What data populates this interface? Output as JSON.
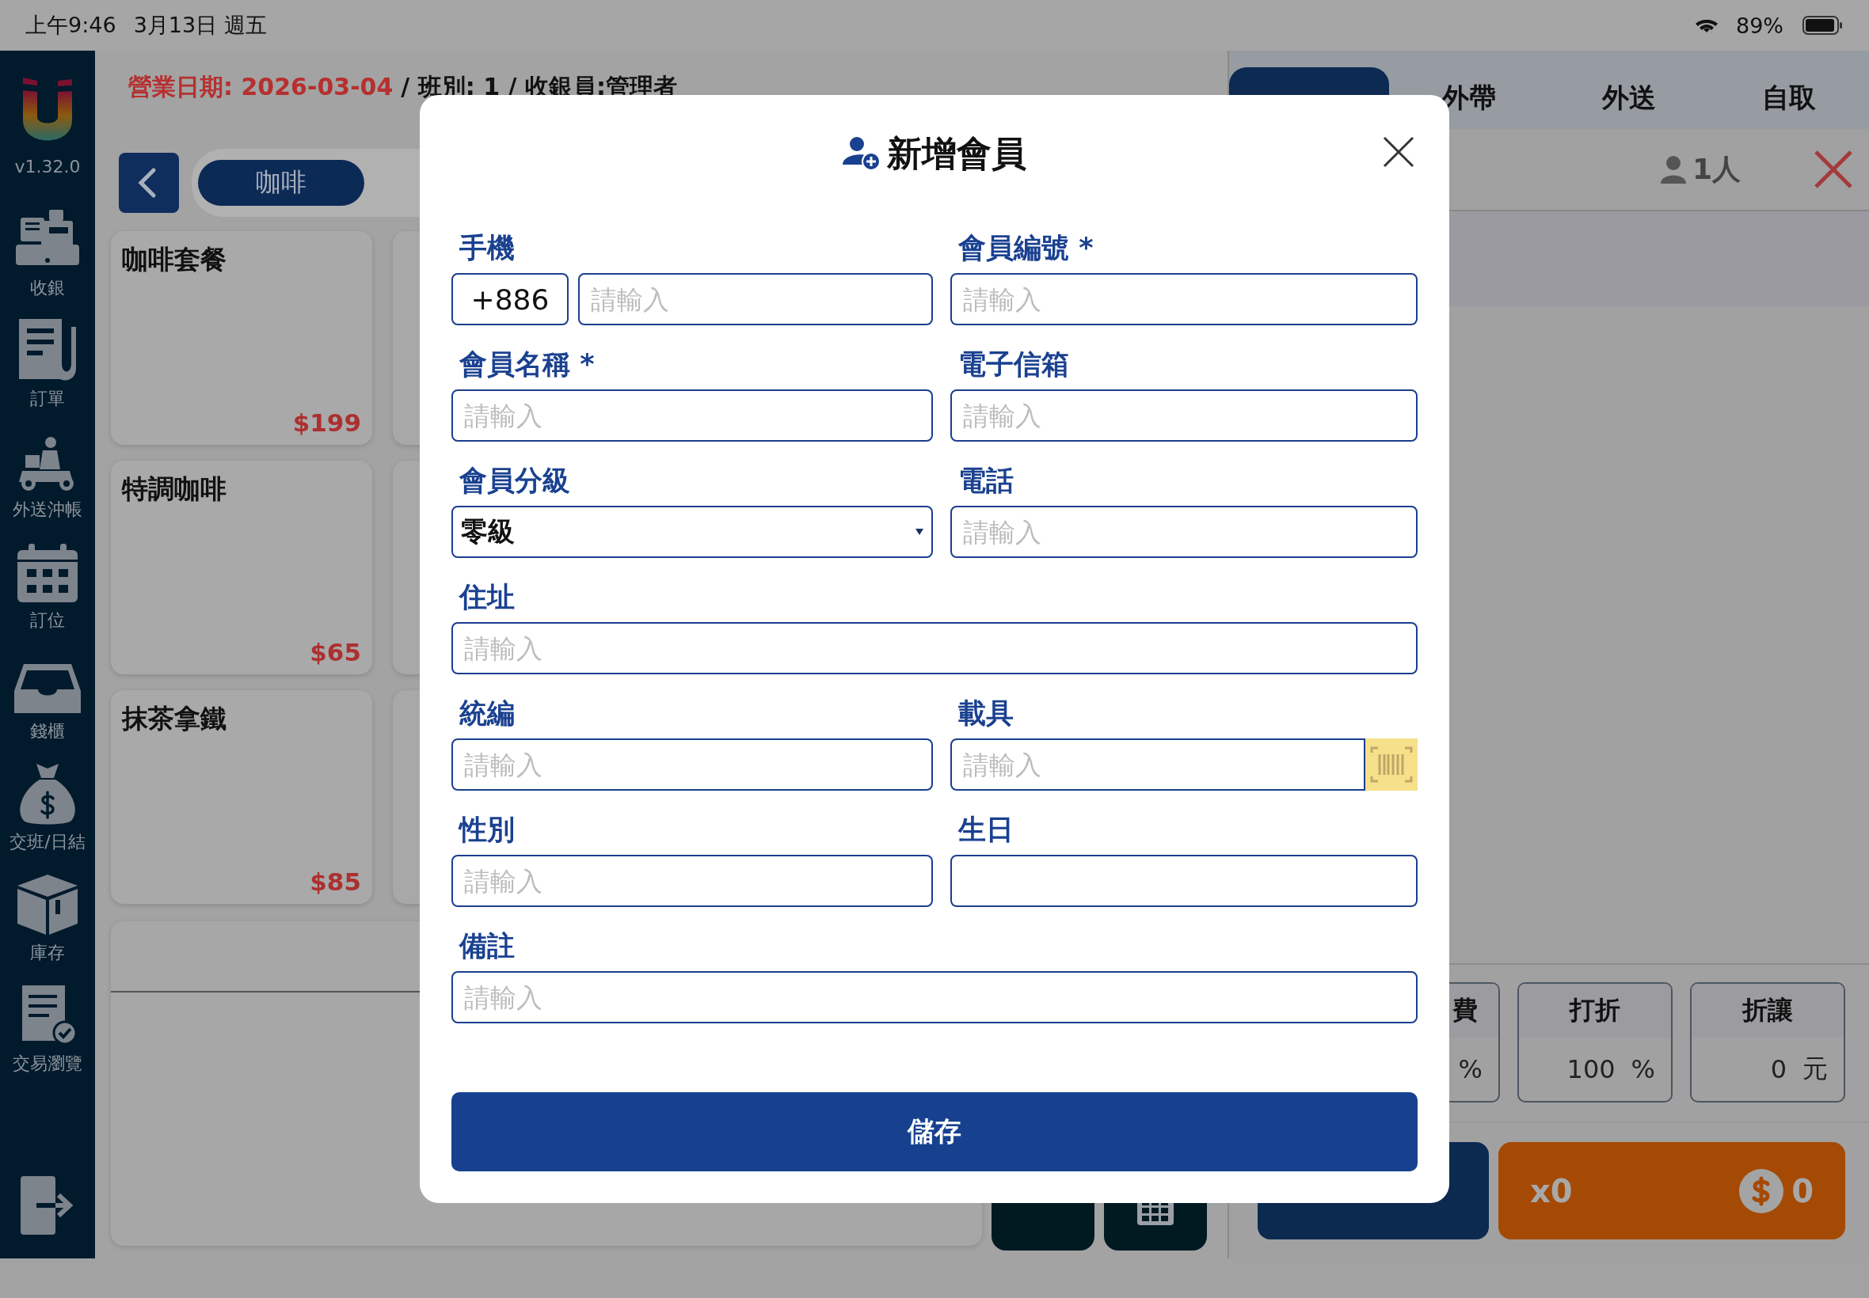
{
  "status_bar": {
    "time": "上午9:46",
    "date": "3月13日 週五",
    "battery": "89%"
  },
  "sidebar": {
    "version": "v1.32.0",
    "items": [
      {
        "label": "收銀"
      },
      {
        "label": "訂單"
      },
      {
        "label": "外送沖帳"
      },
      {
        "label": "訂位"
      },
      {
        "label": "錢櫃"
      },
      {
        "label": "交班/日結"
      },
      {
        "label": "庫存"
      },
      {
        "label": "交易瀏覽"
      }
    ]
  },
  "header": {
    "business_date": "營業日期: 2026-03-04",
    "shift_info": "/ 班別: 1 / 收銀員:管理者"
  },
  "category": {
    "label": "咖啡",
    "selected": true
  },
  "products": [
    {
      "name": "咖啡套餐",
      "price": "$199"
    },
    {
      "name": "特調咖啡",
      "price": "$65"
    },
    {
      "name": "抹茶拿鐵",
      "price": "$85"
    }
  ],
  "order_tabs": [
    {
      "selected": true
    },
    {
      "label": "外帶",
      "selected": false
    },
    {
      "label": "外送",
      "selected": false
    },
    {
      "label": "自取",
      "selected": false
    }
  ],
  "guests": "1人",
  "adjustments": [
    {
      "label": "費",
      "unit": "%"
    },
    {
      "label": "打折",
      "value": "100",
      "unit": "%"
    },
    {
      "label": "折讓",
      "value": "0",
      "unit": "元"
    }
  ],
  "checkout": {
    "count": "x0",
    "total": "0"
  },
  "dialog": {
    "title": "新增會員",
    "save": "儲存",
    "fields": [
      {
        "kind": "phone",
        "label": "手機",
        "prefix": "+886",
        "placeholder": "請輸入"
      },
      {
        "kind": "text",
        "label": "會員編號 *",
        "placeholder": "請輸入"
      },
      {
        "kind": "text",
        "label": "會員名稱 *",
        "placeholder": "請輸入"
      },
      {
        "kind": "text",
        "label": "電子信箱",
        "placeholder": "請輸入"
      },
      {
        "kind": "select",
        "label": "會員分級",
        "value": "零級"
      },
      {
        "kind": "text",
        "label": "電話",
        "placeholder": "請輸入"
      },
      {
        "kind": "text",
        "label": "住址",
        "placeholder": "請輸入",
        "full_width": true
      },
      {
        "kind": "text",
        "label": "統編",
        "placeholder": "請輸入"
      },
      {
        "kind": "barcode",
        "label": "載具",
        "placeholder": "請輸入"
      },
      {
        "kind": "text",
        "label": "性別",
        "placeholder": "請輸入"
      },
      {
        "kind": "date",
        "label": "生日"
      },
      {
        "kind": "text",
        "label": "備註",
        "placeholder": "請輸入",
        "full_width": true
      }
    ]
  }
}
